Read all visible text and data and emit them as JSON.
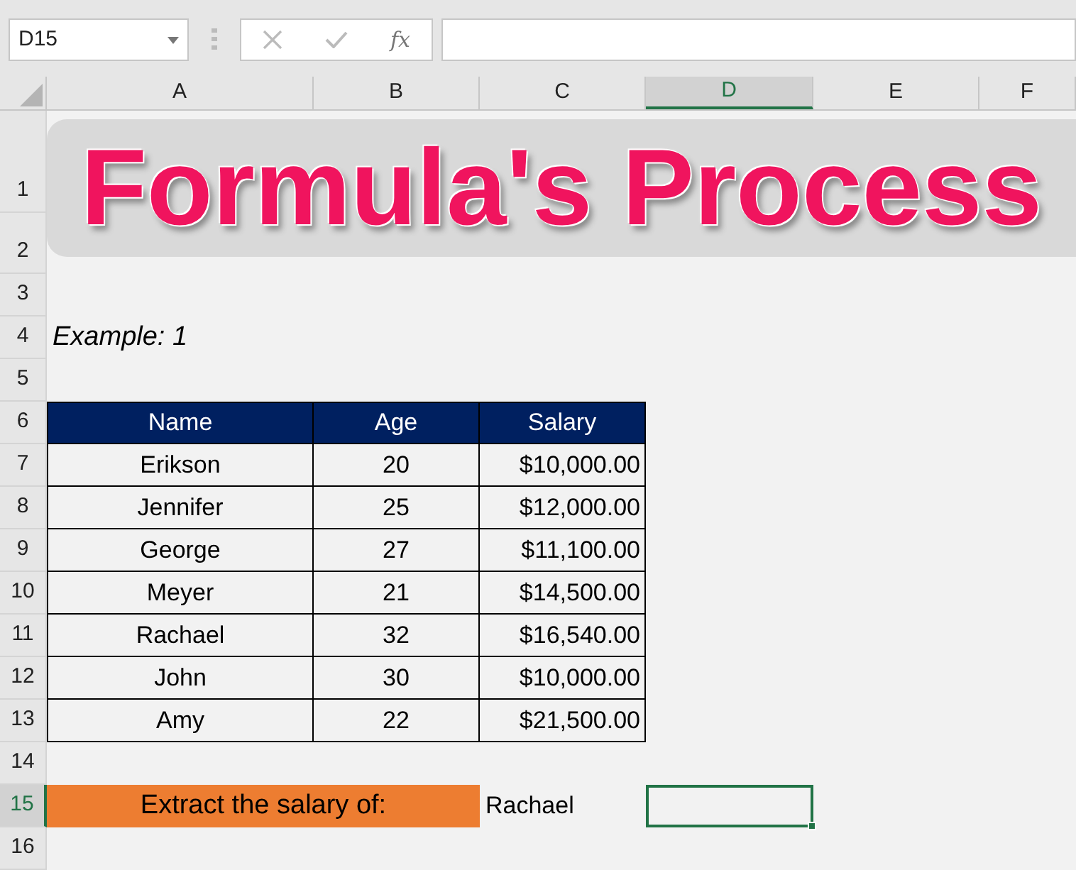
{
  "formula_bar": {
    "name_box": "D15",
    "function_label": "fx"
  },
  "columns": [
    {
      "label": "A",
      "selected": false
    },
    {
      "label": "B",
      "selected": false
    },
    {
      "label": "C",
      "selected": false
    },
    {
      "label": "D",
      "selected": true
    },
    {
      "label": "E",
      "selected": false
    },
    {
      "label": "F",
      "selected": false
    }
  ],
  "row_headers": [
    {
      "label": "1",
      "selected": false
    },
    {
      "label": "2",
      "selected": false
    },
    {
      "label": "3",
      "selected": false
    },
    {
      "label": "4",
      "selected": false
    },
    {
      "label": "5",
      "selected": false
    },
    {
      "label": "6",
      "selected": false
    },
    {
      "label": "7",
      "selected": false
    },
    {
      "label": "8",
      "selected": false
    },
    {
      "label": "9",
      "selected": false
    },
    {
      "label": "10",
      "selected": false
    },
    {
      "label": "11",
      "selected": false
    },
    {
      "label": "12",
      "selected": false
    },
    {
      "label": "13",
      "selected": false
    },
    {
      "label": "14",
      "selected": false
    },
    {
      "label": "15",
      "selected": true
    },
    {
      "label": "16",
      "selected": false
    }
  ],
  "title_banner": "Formula's Process",
  "example_label": "Example: 1",
  "table": {
    "columns": [
      "Name",
      "Age",
      "Salary"
    ],
    "rows": [
      [
        "Erikson",
        "20",
        "$10,000.00"
      ],
      [
        "Jennifer",
        "25",
        "$12,000.00"
      ],
      [
        "George",
        "27",
        "$11,100.00"
      ],
      [
        "Meyer",
        "21",
        "$14,500.00"
      ],
      [
        "Rachael",
        "32",
        "$16,540.00"
      ],
      [
        "John",
        "30",
        "$10,000.00"
      ],
      [
        "Amy",
        "22",
        "$21,500.00"
      ]
    ]
  },
  "extract": {
    "label": "Extract the salary of:",
    "value": "Rachael"
  }
}
